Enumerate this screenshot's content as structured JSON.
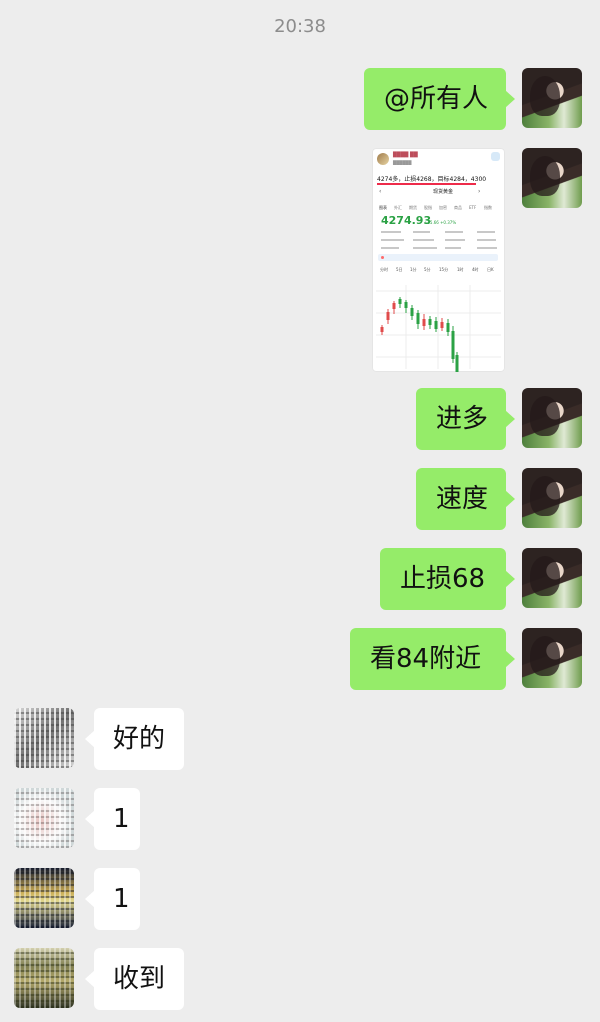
{
  "timestamp": "20:38",
  "messages": [
    {
      "side": "right",
      "type": "text",
      "text": "@所有人"
    },
    {
      "side": "right",
      "type": "image",
      "image": {
        "header_line": "4274多，止损4268，目标4284，4300",
        "instrument": "现货黄金",
        "price": "4274.93",
        "change": "+15.66 +0.37%",
        "tabs": [
          "图表",
          "外汇",
          "期货",
          "股指",
          "加密",
          "商品",
          "ETF",
          "指数"
        ],
        "periods": [
          "分时",
          "5日",
          "1分",
          "5分",
          "15分",
          "1时",
          "4时",
          "日K"
        ]
      }
    },
    {
      "side": "right",
      "type": "text",
      "text": "进多"
    },
    {
      "side": "right",
      "type": "text",
      "text": "速度"
    },
    {
      "side": "right",
      "type": "text",
      "text": "止损68"
    },
    {
      "side": "right",
      "type": "text",
      "text": "看84附近"
    },
    {
      "side": "left",
      "type": "text",
      "text": "好的"
    },
    {
      "side": "left",
      "type": "text",
      "text": "1"
    },
    {
      "side": "left",
      "type": "text",
      "text": "1"
    },
    {
      "side": "left",
      "type": "text",
      "text": "收到"
    }
  ],
  "colors": {
    "background": "#ededed",
    "outgoing_bubble": "#95ec69",
    "incoming_bubble": "#ffffff",
    "timestamp_text": "#8c8c8c"
  }
}
